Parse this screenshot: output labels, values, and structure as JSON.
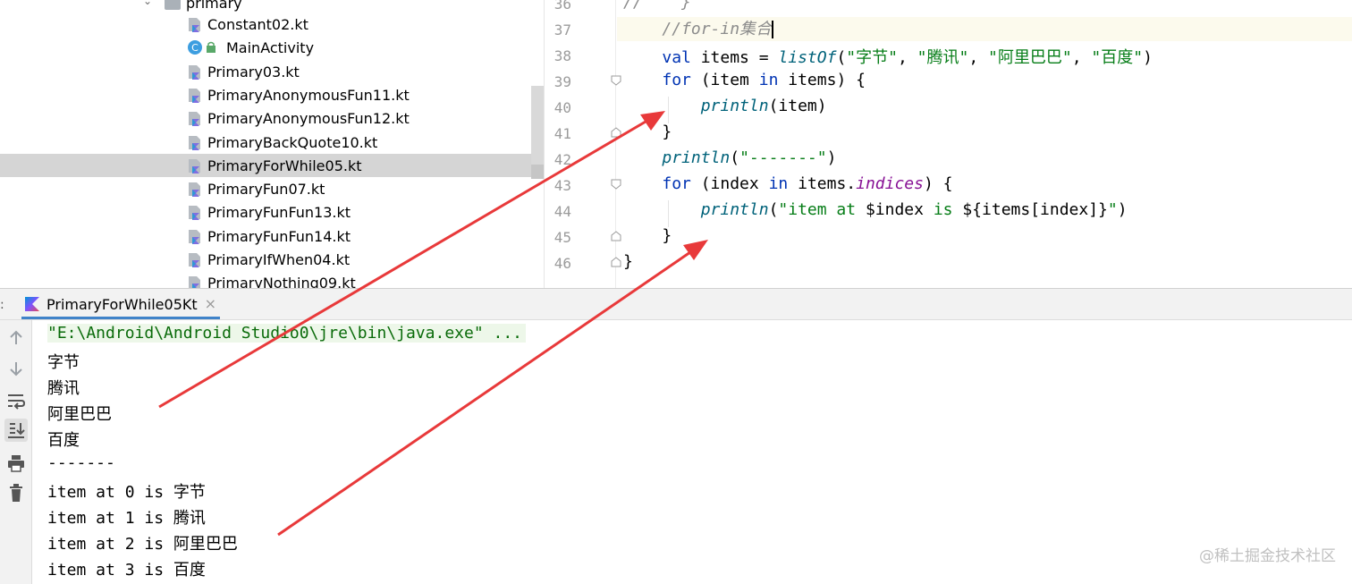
{
  "project_tree": {
    "folder_label": "primary",
    "items": [
      {
        "label": "Constant02.kt",
        "type": "kotlin"
      },
      {
        "label": "MainActivity",
        "type": "activity"
      },
      {
        "label": "Primary03.kt",
        "type": "kotlin"
      },
      {
        "label": "PrimaryAnonymousFun11.kt",
        "type": "kotlin"
      },
      {
        "label": "PrimaryAnonymousFun12.kt",
        "type": "kotlin"
      },
      {
        "label": "PrimaryBackQuote10.kt",
        "type": "kotlin"
      },
      {
        "label": "PrimaryForWhile05.kt",
        "type": "kotlin",
        "selected": true
      },
      {
        "label": "PrimaryFun07.kt",
        "type": "kotlin"
      },
      {
        "label": "PrimaryFunFun13.kt",
        "type": "kotlin"
      },
      {
        "label": "PrimaryFunFun14.kt",
        "type": "kotlin"
      },
      {
        "label": "PrimaryIfWhen04.kt",
        "type": "kotlin"
      },
      {
        "label": "PrimaryNothing09.kt",
        "type": "kotlin"
      }
    ]
  },
  "editor": {
    "line_numbers": [
      "36",
      "37",
      "38",
      "39",
      "40",
      "41",
      "42",
      "43",
      "44",
      "45",
      "46"
    ],
    "code": {
      "l36": "//    }",
      "l37_comment": "//for-in集合",
      "l38_val": "val",
      "l38_items": " items = ",
      "l38_fn": "listOf",
      "l38_open": "(",
      "l38_s1": "\"字节\"",
      "l38_s2": "\"腾讯\"",
      "l38_s3": "\"阿里巴巴\"",
      "l38_s4": "\"百度\"",
      "l38_comma": ", ",
      "l38_close": ")",
      "l39_for": "for",
      "l39_a": " (item ",
      "l39_in": "in",
      "l39_b": " items) {",
      "l40_fn": "println",
      "l40_rest": "(item)",
      "l41": "}",
      "l42_fn": "println",
      "l42_open": "(",
      "l42_str": "\"-------\"",
      "l42_close": ")",
      "l43_for": "for",
      "l43_a": " (index ",
      "l43_in": "in",
      "l43_b": " items.",
      "l43_prop": "indices",
      "l43_c": ") {",
      "l44_fn": "println",
      "l44_open": "(",
      "l44_str1": "\"item at ",
      "l44_tmpl1": "$index",
      "l44_str2": " is ",
      "l44_tmpl2": "${items[index]}",
      "l44_str3": "\"",
      "l44_close": ")",
      "l45": "}",
      "l46": "}"
    }
  },
  "run_window": {
    "tab_label": "PrimaryForWhile05Kt",
    "close_glyph": "×",
    "left_marker": ":",
    "toolbar": [
      "up-arrow-icon",
      "down-arrow-icon",
      "soft-wrap-icon",
      "scroll-to-end-icon",
      "print-icon",
      "trash-icon"
    ],
    "output": [
      "\"E:\\Android\\Android Studio0\\jre\\bin\\java.exe\" ...",
      "字节",
      "腾讯",
      "阿里巴巴",
      "百度",
      "-------",
      "item at 0 is 字节",
      "item at 1 is 腾讯",
      "item at 2 is 阿里巴巴",
      "item at 3 is 百度"
    ]
  },
  "watermark": "@稀土掘金技术社区",
  "colors": {
    "annotation_arrow": "#e8393a",
    "keyword": "#0033b3",
    "string": "#067d17",
    "function": "#00627a",
    "selection": "#d5d5d5",
    "tab_underline": "#4083c9"
  }
}
